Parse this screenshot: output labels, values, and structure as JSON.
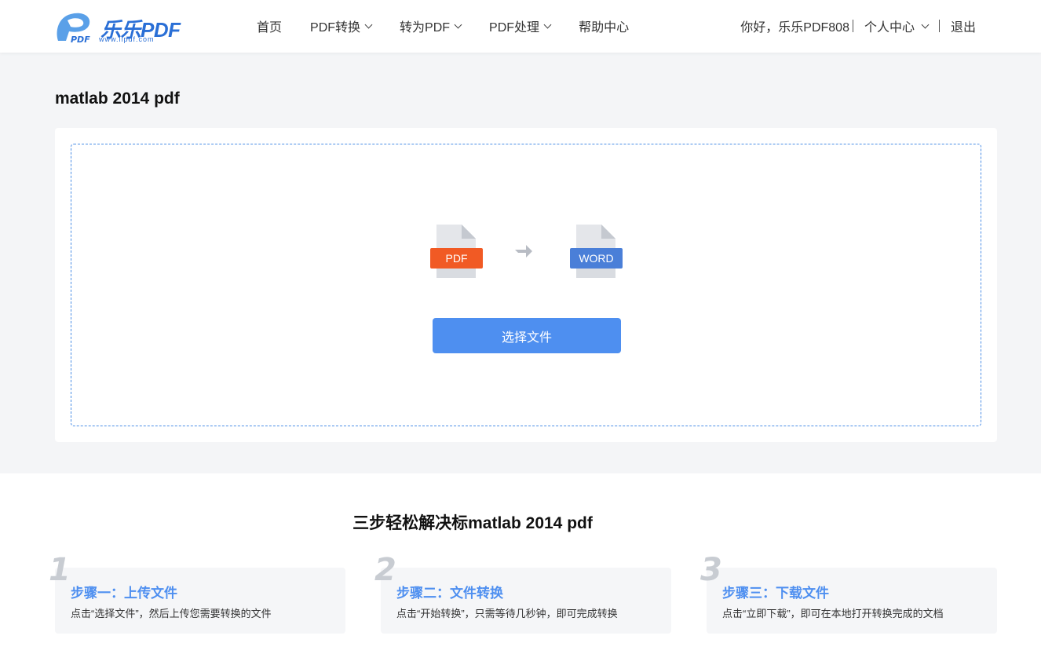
{
  "header": {
    "logo_text": "乐乐PDF",
    "logo_sub": "www.llpdf.com",
    "nav": [
      {
        "label": "首页",
        "has_dropdown": false
      },
      {
        "label": "PDF转换",
        "has_dropdown": true
      },
      {
        "label": "转为PDF",
        "has_dropdown": true
      },
      {
        "label": "PDF处理",
        "has_dropdown": true
      },
      {
        "label": "帮助中心",
        "has_dropdown": false
      }
    ],
    "greeting": "你好，乐乐PDF808",
    "user_center": "个人中心",
    "logout": "退出"
  },
  "main": {
    "title": "matlab 2014 pdf",
    "from_label": "PDF",
    "to_label": "WORD",
    "choose_button": "选择文件"
  },
  "steps": {
    "title": "三步轻松解决标matlab 2014 pdf",
    "items": [
      {
        "num": "1",
        "title": "步骤一：上传文件",
        "desc": "点击“选择文件”，然后上传您需要转换的文件"
      },
      {
        "num": "2",
        "title": "步骤二：文件转换",
        "desc": "点击“开始转换”，只需等待几秒钟，即可完成转换"
      },
      {
        "num": "3",
        "title": "步骤三：下载文件",
        "desc": "点击“立即下载”，即可在本地打开转换完成的文档"
      }
    ]
  },
  "colors": {
    "accent": "#4e8ff0",
    "pdf_badge": "#f15a24",
    "word_badge": "#4a7fd8"
  }
}
